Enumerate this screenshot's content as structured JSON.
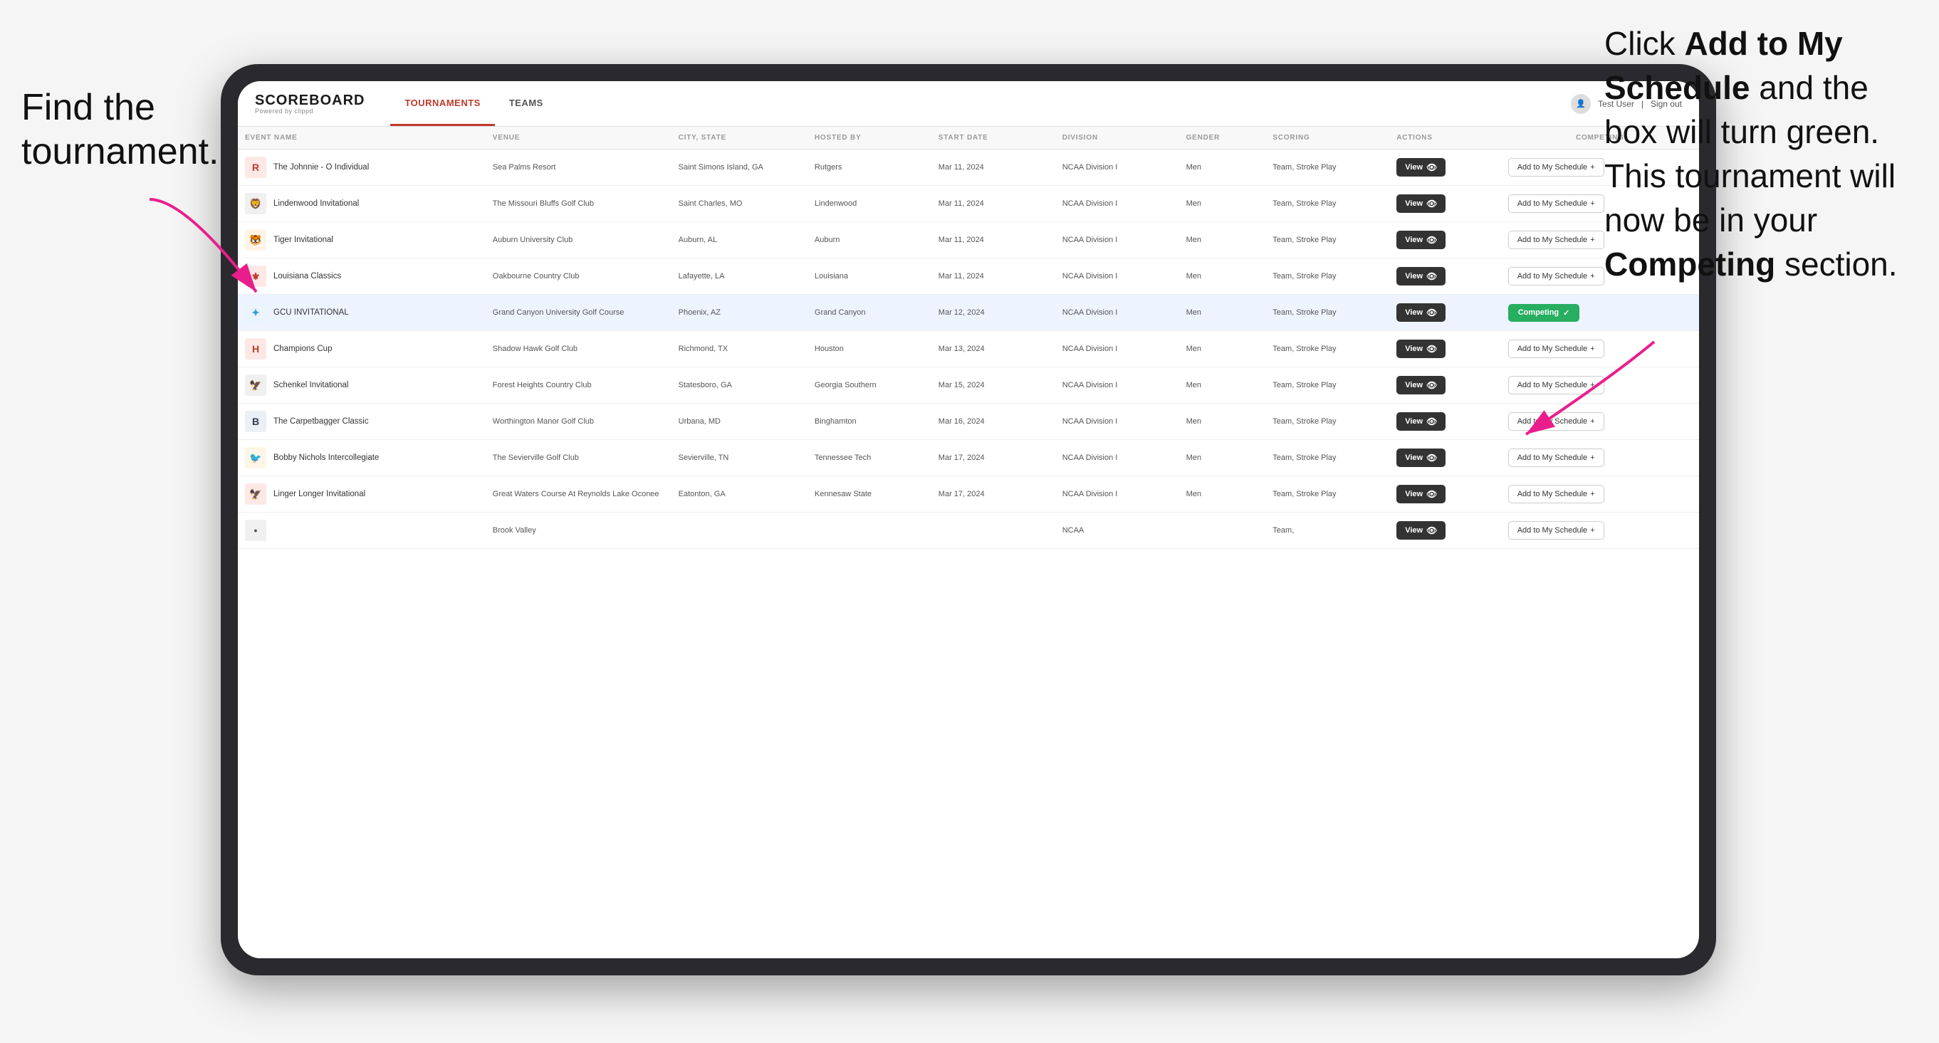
{
  "page": {
    "background": "#f5f5f5"
  },
  "annotations": {
    "left": {
      "line1": "Find the",
      "line2": "tournament."
    },
    "right": {
      "text_before": "Click ",
      "bold1": "Add to My Schedule",
      "text_middle": " and the box will turn green. This tournament will now be in your ",
      "bold2": "Competing",
      "text_after": " section."
    }
  },
  "nav": {
    "logo": "SCOREBOARD",
    "logo_sub": "Powered by clippd",
    "tabs": [
      {
        "label": "TOURNAMENTS",
        "active": true
      },
      {
        "label": "TEAMS",
        "active": false
      }
    ],
    "user": "Test User",
    "sign_out": "Sign out"
  },
  "table": {
    "headers": [
      "EVENT NAME",
      "VENUE",
      "CITY, STATE",
      "HOSTED BY",
      "START DATE",
      "DIVISION",
      "GENDER",
      "SCORING",
      "ACTIONS",
      "COMPETING"
    ],
    "rows": [
      {
        "logo": "R",
        "logo_color": "#c0392b",
        "logo_bg": "#fde8e6",
        "event": "The Johnnie - O Individual",
        "venue": "Sea Palms Resort",
        "city": "Saint Simons Island, GA",
        "hosted": "Rutgers",
        "start": "Mar 11, 2024",
        "division": "NCAA Division I",
        "gender": "Men",
        "scoring": "Team, Stroke Play",
        "highlighted": false,
        "status": "add"
      },
      {
        "logo": "🦁",
        "logo_color": "#555",
        "logo_bg": "#f0f0f0",
        "event": "Lindenwood Invitational",
        "venue": "The Missouri Bluffs Golf Club",
        "city": "Saint Charles, MO",
        "hosted": "Lindenwood",
        "start": "Mar 11, 2024",
        "division": "NCAA Division I",
        "gender": "Men",
        "scoring": "Team, Stroke Play",
        "highlighted": false,
        "status": "add"
      },
      {
        "logo": "🐯",
        "logo_color": "#e67e22",
        "logo_bg": "#fef5e7",
        "event": "Tiger Invitational",
        "venue": "Auburn University Club",
        "city": "Auburn, AL",
        "hosted": "Auburn",
        "start": "Mar 11, 2024",
        "division": "NCAA Division I",
        "gender": "Men",
        "scoring": "Team, Stroke Play",
        "highlighted": false,
        "status": "add"
      },
      {
        "logo": "⚜",
        "logo_color": "#c0392b",
        "logo_bg": "#fde8e6",
        "event": "Louisiana Classics",
        "venue": "Oakbourne Country Club",
        "city": "Lafayette, LA",
        "hosted": "Louisiana",
        "start": "Mar 11, 2024",
        "division": "NCAA Division I",
        "gender": "Men",
        "scoring": "Team, Stroke Play",
        "highlighted": false,
        "status": "add"
      },
      {
        "logo": "✦",
        "logo_color": "#3498db",
        "logo_bg": "#eaf4fd",
        "event": "GCU INVITATIONAL",
        "venue": "Grand Canyon University Golf Course",
        "city": "Phoenix, AZ",
        "hosted": "Grand Canyon",
        "start": "Mar 12, 2024",
        "division": "NCAA Division I",
        "gender": "Men",
        "scoring": "Team, Stroke Play",
        "highlighted": true,
        "status": "competing"
      },
      {
        "logo": "H",
        "logo_color": "#c0392b",
        "logo_bg": "#fde8e6",
        "event": "Champions Cup",
        "venue": "Shadow Hawk Golf Club",
        "city": "Richmond, TX",
        "hosted": "Houston",
        "start": "Mar 13, 2024",
        "division": "NCAA Division I",
        "gender": "Men",
        "scoring": "Team, Stroke Play",
        "highlighted": false,
        "status": "add"
      },
      {
        "logo": "🦅",
        "logo_color": "#555",
        "logo_bg": "#f0f0f0",
        "event": "Schenkel Invitational",
        "venue": "Forest Heights Country Club",
        "city": "Statesboro, GA",
        "hosted": "Georgia Southern",
        "start": "Mar 15, 2024",
        "division": "NCAA Division I",
        "gender": "Men",
        "scoring": "Team, Stroke Play",
        "highlighted": false,
        "status": "add"
      },
      {
        "logo": "B",
        "logo_color": "#2c3e50",
        "logo_bg": "#eaf0f6",
        "event": "The Carpetbagger Classic",
        "venue": "Worthington Manor Golf Club",
        "city": "Urbana, MD",
        "hosted": "Binghamton",
        "start": "Mar 16, 2024",
        "division": "NCAA Division I",
        "gender": "Men",
        "scoring": "Team, Stroke Play",
        "highlighted": false,
        "status": "add"
      },
      {
        "logo": "🐦",
        "logo_color": "#e67e22",
        "logo_bg": "#fef5e7",
        "event": "Bobby Nichols Intercollegiate",
        "venue": "The Sevierville Golf Club",
        "city": "Sevierville, TN",
        "hosted": "Tennessee Tech",
        "start": "Mar 17, 2024",
        "division": "NCAA Division I",
        "gender": "Men",
        "scoring": "Team, Stroke Play",
        "highlighted": false,
        "status": "add"
      },
      {
        "logo": "🦅",
        "logo_color": "#c0392b",
        "logo_bg": "#fde8e6",
        "event": "Linger Longer Invitational",
        "venue": "Great Waters Course At Reynolds Lake Oconee",
        "city": "Eatonton, GA",
        "hosted": "Kennesaw State",
        "start": "Mar 17, 2024",
        "division": "NCAA Division I",
        "gender": "Men",
        "scoring": "Team, Stroke Play",
        "highlighted": false,
        "status": "add"
      },
      {
        "logo": "•",
        "logo_color": "#555",
        "logo_bg": "#f0f0f0",
        "event": "",
        "venue": "Brook Valley",
        "city": "",
        "hosted": "",
        "start": "",
        "division": "NCAA",
        "gender": "",
        "scoring": "Team,",
        "highlighted": false,
        "status": "add_partial"
      }
    ],
    "add_btn_label": "Add to My Schedule",
    "add_btn_plus": "+",
    "competing_label": "Competing",
    "competing_check": "✓",
    "view_label": "View"
  }
}
